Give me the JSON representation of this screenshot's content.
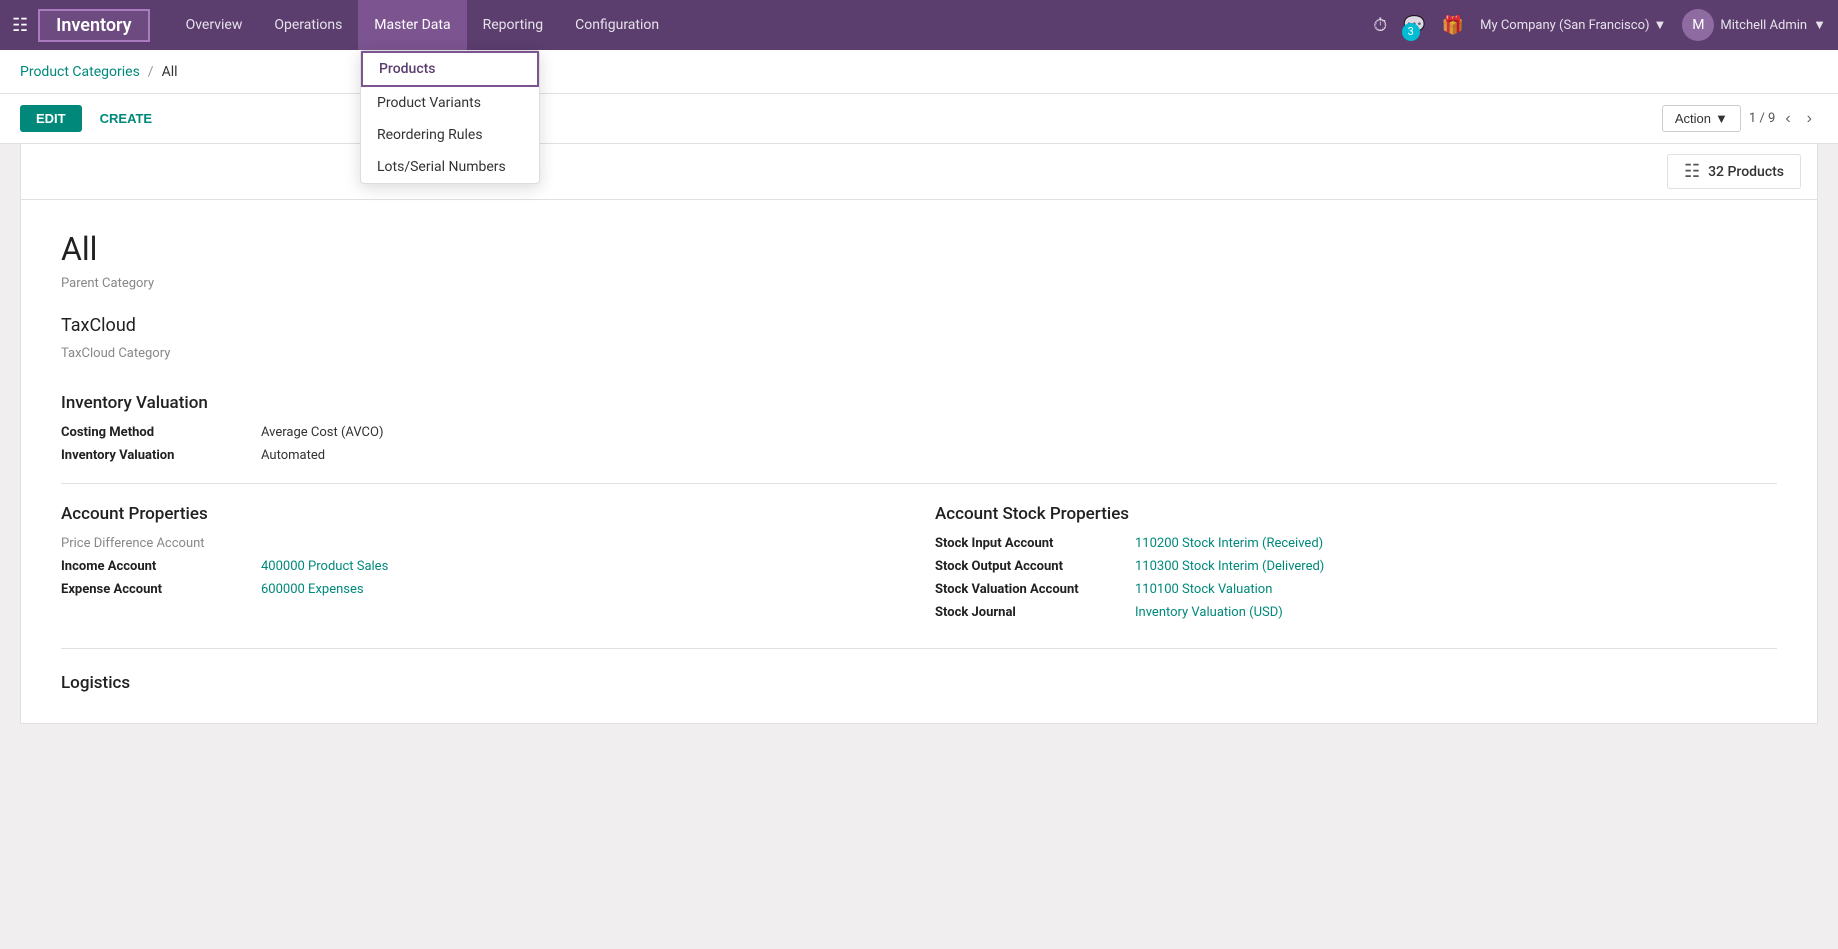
{
  "app": {
    "name": "Inventory"
  },
  "topnav": {
    "items": [
      {
        "id": "overview",
        "label": "Overview",
        "active": false
      },
      {
        "id": "operations",
        "label": "Operations",
        "active": false
      },
      {
        "id": "master_data",
        "label": "Master Data",
        "active": true
      },
      {
        "id": "reporting",
        "label": "Reporting",
        "active": false
      },
      {
        "id": "configuration",
        "label": "Configuration",
        "active": false
      }
    ],
    "company": "My Company (San Francisco)",
    "user": "Mitchell Admin",
    "message_count": "3"
  },
  "master_data_dropdown": {
    "items": [
      {
        "id": "products",
        "label": "Products",
        "active": true
      },
      {
        "id": "product_variants",
        "label": "Product Variants",
        "active": false
      },
      {
        "id": "reordering_rules",
        "label": "Reordering Rules",
        "active": false
      },
      {
        "id": "lots_serial",
        "label": "Lots/Serial Numbers",
        "active": false
      }
    ]
  },
  "breadcrumb": {
    "parent": "Product Categories",
    "separator": "/",
    "current": "All"
  },
  "toolbar": {
    "edit_label": "EDIT",
    "create_label": "CREATE",
    "action_label": "Action",
    "pagination_current": "1",
    "pagination_total": "9"
  },
  "products_count": {
    "count": "32",
    "label": "Products"
  },
  "record": {
    "title": "All",
    "parent_category_label": "Parent Category",
    "parent_category_value": "",
    "taxcloud_label": "TaxCloud",
    "taxcloud_category_label": "TaxCloud Category",
    "taxcloud_category_value": "",
    "inventory_valuation_section": "Inventory Valuation",
    "costing_method_label": "Costing Method",
    "costing_method_value": "Average Cost (AVCO)",
    "inventory_valuation_label": "Inventory Valuation",
    "inventory_valuation_value": "Automated",
    "account_properties_section": "Account Properties",
    "price_diff_label": "Price Difference Account",
    "price_diff_value": "",
    "income_account_label": "Income Account",
    "income_account_value": "400000 Product Sales",
    "expense_account_label": "Expense Account",
    "expense_account_value": "600000 Expenses",
    "account_stock_section": "Account Stock Properties",
    "stock_input_label": "Stock Input Account",
    "stock_input_value": "110200 Stock Interim (Received)",
    "stock_output_label": "Stock Output Account",
    "stock_output_value": "110300 Stock Interim (Delivered)",
    "stock_valuation_label": "Stock Valuation Account",
    "stock_valuation_value": "110100 Stock Valuation",
    "stock_journal_label": "Stock Journal",
    "stock_journal_value": "Inventory Valuation (USD)",
    "logistics_section": "Logistics"
  }
}
